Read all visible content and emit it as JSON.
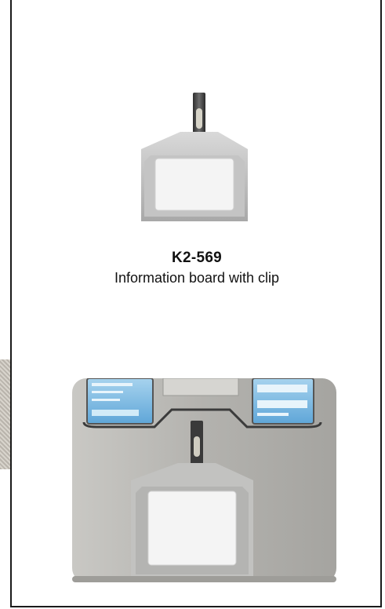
{
  "product": {
    "code": "K2-569",
    "description": "Information board with clip"
  },
  "colors": {
    "border": "#1a1a1a",
    "text": "#111111",
    "board_white": "#f4f4f4",
    "board_frame": "#c9c9c9",
    "device_body": "#bdbcb8"
  }
}
